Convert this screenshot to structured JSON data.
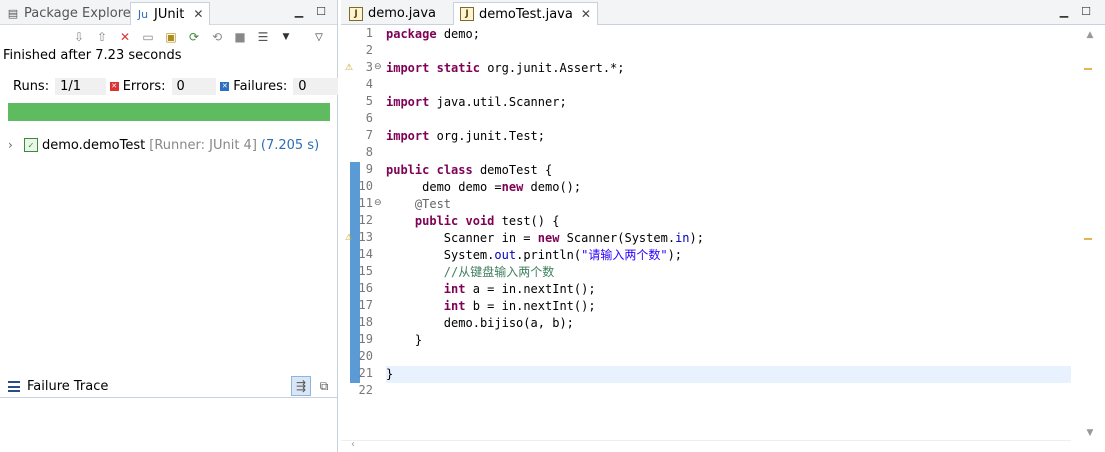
{
  "left_panel": {
    "tabs": [
      {
        "label": "Package Explorer",
        "icon": "package-explorer-icon"
      },
      {
        "label": "JUnit",
        "icon": "junit-icon",
        "active": true
      }
    ],
    "status_text": "Finished after 7.23 seconds",
    "counters": {
      "runs_label": "Runs:",
      "runs_value": "1/1",
      "errors_label": "Errors:",
      "errors_value": "0",
      "failures_label": "Failures:",
      "failures_value": "0"
    },
    "progress_fraction": 1.0,
    "progress_color": "#5fbb5f",
    "tree": [
      {
        "name": "demo.demoTest",
        "runner": "[Runner: JUnit 4]",
        "time": "(7.205 s)"
      }
    ],
    "failure_trace_label": "Failure Trace"
  },
  "editor": {
    "tabs": [
      {
        "label": "demo.java"
      },
      {
        "label": "demoTest.java",
        "active": true
      }
    ],
    "current_line": 21,
    "lines": [
      {
        "no": "1",
        "text": "package demo;"
      },
      {
        "no": "2",
        "text": ""
      },
      {
        "no": "3",
        "text": "import static org.junit.Assert.*;",
        "fold": true,
        "warning": true
      },
      {
        "no": "4",
        "text": ""
      },
      {
        "no": "5",
        "text": "import java.util.Scanner;"
      },
      {
        "no": "6",
        "text": ""
      },
      {
        "no": "7",
        "text": "import org.junit.Test;"
      },
      {
        "no": "8",
        "text": ""
      },
      {
        "no": "9",
        "text": "public class demoTest {"
      },
      {
        "no": "10",
        "text": "     demo demo =new demo();"
      },
      {
        "no": "11",
        "text": "    @Test",
        "fold": true
      },
      {
        "no": "12",
        "text": "    public void test() {"
      },
      {
        "no": "13",
        "text": "        Scanner in = new Scanner(System.in);",
        "warning": true
      },
      {
        "no": "14",
        "text": "        System.out.println(\"请输入两个数\");"
      },
      {
        "no": "15",
        "text": "        //从键盘输入两个数"
      },
      {
        "no": "16",
        "text": "        int a = in.nextInt();"
      },
      {
        "no": "17",
        "text": "        int b = in.nextInt();"
      },
      {
        "no": "18",
        "text": "        demo.bijiso(a, b);"
      },
      {
        "no": "19",
        "text": "    }"
      },
      {
        "no": "20",
        "text": ""
      },
      {
        "no": "21",
        "text": "}"
      },
      {
        "no": "22",
        "text": ""
      }
    ]
  }
}
